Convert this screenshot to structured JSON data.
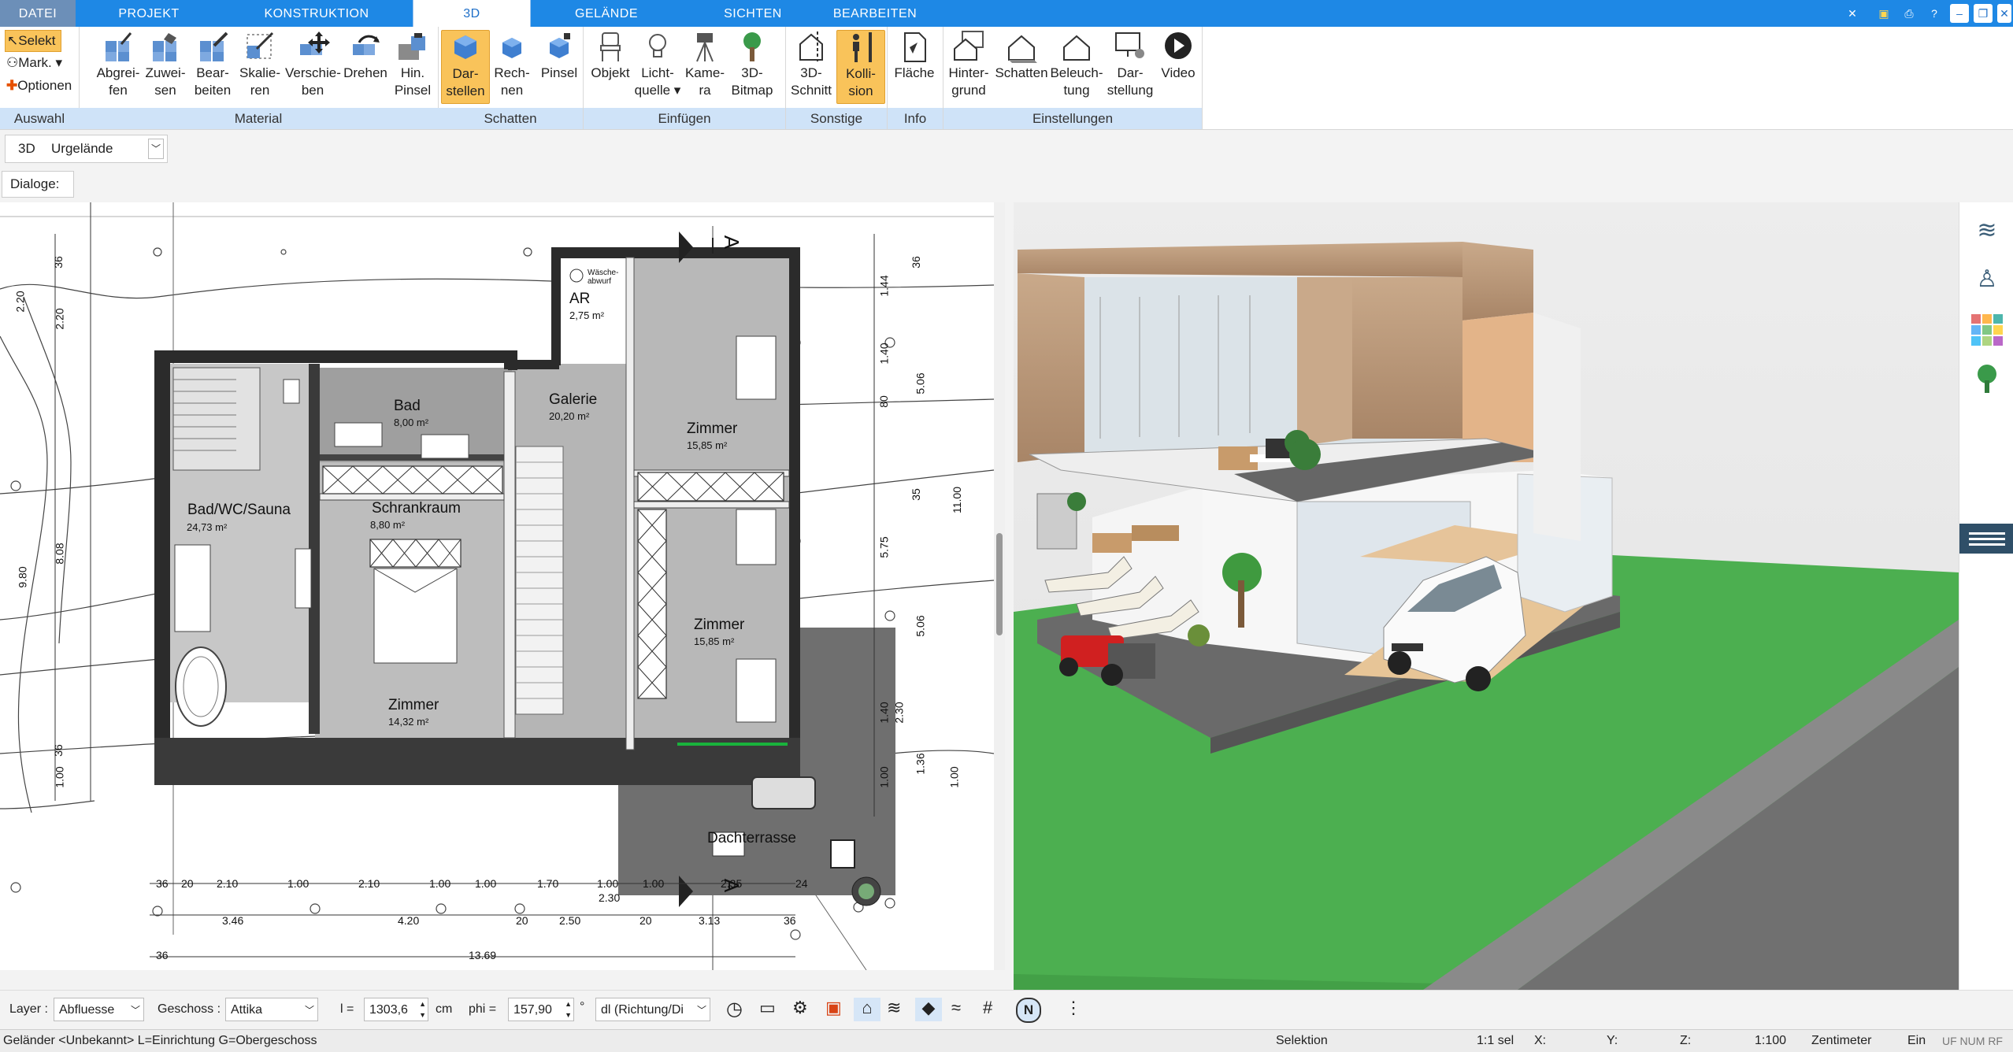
{
  "tabs": {
    "file": "DATEI",
    "project": "PROJEKT",
    "construction": "KONSTRUKTION",
    "view3d": "3D",
    "terrain": "GELÄNDE",
    "views": "SICHTEN",
    "edit": "BEARBEITEN"
  },
  "ribbon": {
    "auswahl": {
      "select": "Selekt",
      "mark": "Mark.",
      "options": "Optionen",
      "label": "Auswahl"
    },
    "material": {
      "label": "Material",
      "pick": [
        "Abgrei-",
        "fen"
      ],
      "assign": [
        "Zuwei-",
        "sen"
      ],
      "edit": [
        "Bear-",
        "beiten"
      ],
      "scale": [
        "Skalie-",
        "ren"
      ],
      "move": [
        "Verschie-",
        "ben"
      ],
      "rotate": [
        "Drehen",
        ""
      ],
      "brush": [
        "Hin.",
        "Pinsel"
      ]
    },
    "schatten": {
      "label": "Schatten",
      "show": [
        "Dar-",
        "stellen"
      ],
      "compute": [
        "Rech-",
        "nen"
      ],
      "brush": [
        "Pinsel",
        ""
      ]
    },
    "einfuegen": {
      "label": "Einfügen",
      "object": [
        "Objekt",
        ""
      ],
      "light": [
        "Licht-",
        "quelle"
      ],
      "camera": [
        "Kame-",
        "ra"
      ],
      "bitmap": [
        "3D-",
        "Bitmap"
      ]
    },
    "sonstige": {
      "label": "Sonstige",
      "section": [
        "3D-",
        "Schnitt"
      ],
      "collision": [
        "Kolli-",
        "sion"
      ]
    },
    "info": {
      "label": "Info",
      "area": [
        "Fläche",
        ""
      ]
    },
    "einstellungen": {
      "label": "Einstellungen",
      "background": [
        "Hinter-",
        "grund"
      ],
      "shadows": [
        "Schatten",
        ""
      ],
      "lighting": [
        "Beleuch-",
        "tung"
      ],
      "display": [
        "Dar-",
        "stellung"
      ],
      "video": [
        "Video",
        ""
      ]
    }
  },
  "toolbar3d": {
    "mode": "3D",
    "terrain_value": "Urgelände"
  },
  "dialogs_label": "Dialoge:",
  "plan": {
    "rooms": [
      {
        "name": "Bad/WC/Sauna",
        "area": "24,73 m²"
      },
      {
        "name": "Bad",
        "area": "8,00 m²"
      },
      {
        "name": "Schrankraum",
        "area": "8,80 m²"
      },
      {
        "name": "Galerie",
        "area": "20,20 m²"
      },
      {
        "name": "Zimmer",
        "area": "15,85 m²"
      },
      {
        "name": "Zimmer",
        "area": "15,85 m²"
      },
      {
        "name": "Zimmer",
        "area": "14,32 m²"
      },
      {
        "name": "AR",
        "area": "2,75 m²"
      },
      {
        "name": "Dachterrasse",
        "area": ""
      }
    ],
    "waesche": [
      "Wäsche-",
      "abwurf"
    ],
    "section_marker": "A",
    "dims_bottom_row1": [
      "36",
      "20",
      "2.10",
      "1.00",
      "2.10",
      "1.00",
      "1.00",
      "1.70",
      "1.00",
      "1.00",
      "2.35",
      "24"
    ],
    "dims_bottom_row2": [
      "3.46",
      "4.20",
      "20",
      "2.50",
      "2.30",
      "20",
      "3.13",
      "36"
    ],
    "dims_bottom_row3": [
      "36",
      "13.69"
    ],
    "dims_left": [
      "2.20",
      "2.20",
      "36",
      "8.08",
      "9.80",
      "36",
      "1.00"
    ],
    "dims_right": [
      "1.44",
      "1.40",
      "80",
      "5.06",
      "35",
      "11.00",
      "5.75",
      "5.06",
      "1.40",
      "2.30",
      "1.00",
      "1.36",
      "1.00",
      "36"
    ]
  },
  "bottom": {
    "layer_label": "Layer :",
    "layer_value": "Abfluesse",
    "floor_label": "Geschoss :",
    "floor_value": "Attika",
    "l_label": "l =",
    "l_value": "1303,6",
    "l_unit": "cm",
    "phi_label": "phi =",
    "phi_value": "157,90",
    "phi_unit": "°",
    "dl_value": "dl (Richtung/Di"
  },
  "status": {
    "hint": "Geländer <Unbekannt> L=Einrichtung G=Obergeschoss",
    "mode": "Selektion",
    "sel": "1:1 sel",
    "x": "X:",
    "y": "Y:",
    "z": "Z:",
    "scale": "1:100",
    "unit": "Zentimeter",
    "ein": "Ein",
    "flags": "UF NUM RF"
  },
  "colors": {
    "accent": "#1e88e5",
    "ribbon_group": "#cfe3f8",
    "active_btn": "#f9c35a",
    "lawn": "#4caf50"
  }
}
